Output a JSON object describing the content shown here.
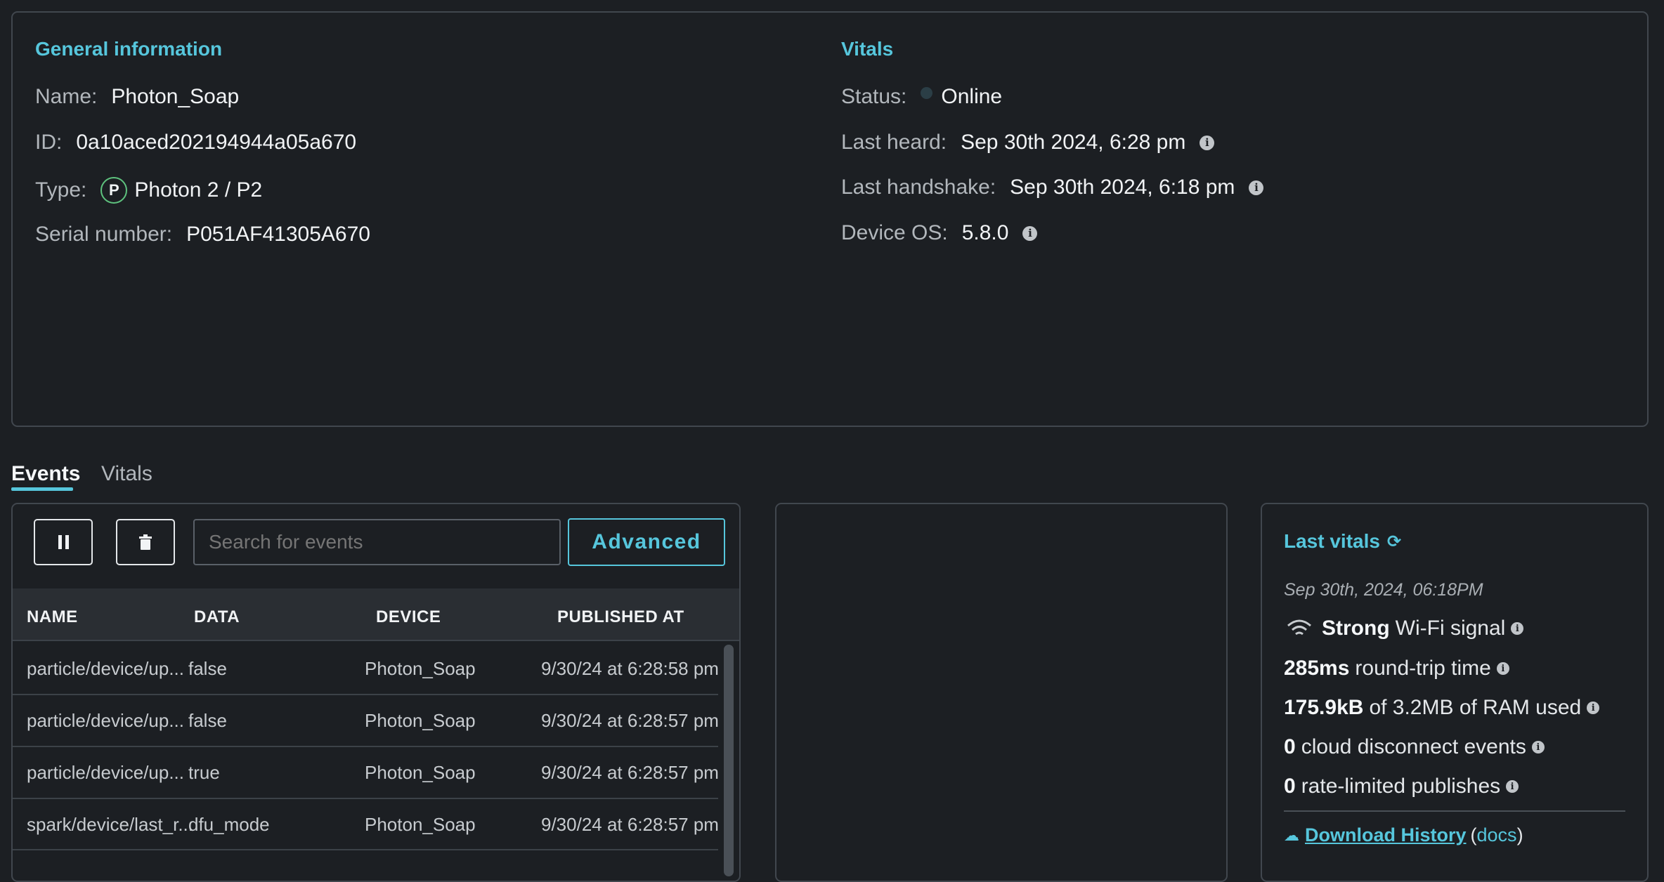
{
  "general": {
    "heading": "General information",
    "name_label": "Name:",
    "name_value": "Photon_Soap",
    "id_label": "ID:",
    "id_value": "0a10aced202194944a05a670",
    "type_label": "Type:",
    "type_badge": "P",
    "type_value": "Photon 2 / P2",
    "serial_label": "Serial number:",
    "serial_value": "P051AF41305A670"
  },
  "vitals": {
    "heading": "Vitals",
    "status_label": "Status:",
    "status_value": "Online",
    "last_heard_label": "Last heard:",
    "last_heard_value": "Sep 30th 2024, 6:28 pm",
    "last_handshake_label": "Last handshake:",
    "last_handshake_value": "Sep 30th 2024, 6:18 pm",
    "os_label": "Device OS:",
    "os_value": "5.8.0"
  },
  "tabs": [
    {
      "label": "Events",
      "active": true
    },
    {
      "label": "Vitals",
      "active": false
    }
  ],
  "events": {
    "search_placeholder": "Search for events",
    "advanced_label": "Advanced",
    "columns": [
      "NAME",
      "DATA",
      "DEVICE",
      "PUBLISHED AT"
    ],
    "rows": [
      [
        "particle/device/up...",
        "false",
        "Photon_Soap",
        "9/30/24 at 6:28:58 pm"
      ],
      [
        "particle/device/up...",
        "false",
        "Photon_Soap",
        "9/30/24 at 6:28:57 pm"
      ],
      [
        "particle/device/up...",
        "true",
        "Photon_Soap",
        "9/30/24 at 6:28:57 pm"
      ],
      [
        "spark/device/last_r...",
        "dfu_mode",
        "Photon_Soap",
        "9/30/24 at 6:28:57 pm"
      ]
    ]
  },
  "last_vitals": {
    "heading": "Last vitals",
    "timestamp": "Sep 30th, 2024, 06:18PM",
    "wifi_strength": "Strong",
    "wifi_text": "Wi-Fi signal",
    "rtt_value": "285ms",
    "rtt_text": "round-trip time",
    "ram_value": "175.9kB",
    "ram_text": "of 3.2MB of RAM used",
    "disconnect_value": "0",
    "disconnect_text": "cloud disconnect events",
    "ratelimit_value": "0",
    "ratelimit_text": "rate-limited publishes",
    "download_label": "Download History",
    "docs_label": "docs"
  },
  "colors": {
    "accent": "#56c6dc",
    "background": "#1c1f23",
    "border": "#41474e"
  }
}
